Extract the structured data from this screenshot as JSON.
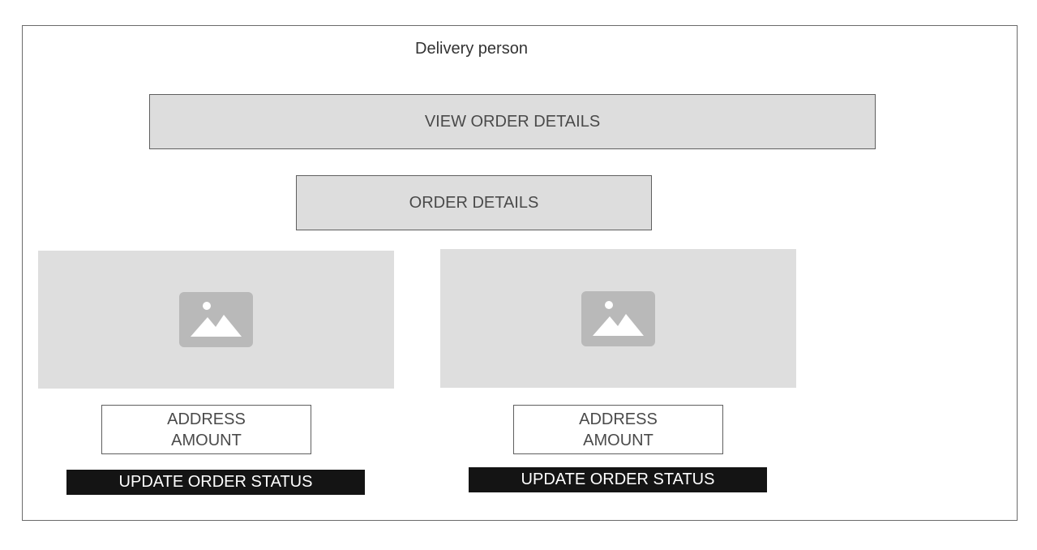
{
  "header": {
    "title": "Delivery person"
  },
  "actions": {
    "view_order_details": "VIEW ORDER DETAILS",
    "order_details": "ORDER DETAILS"
  },
  "orders": [
    {
      "image_icon": "image-placeholder-icon",
      "address": "ADDRESS",
      "amount": "AMOUNT",
      "update_label": "UPDATE ORDER STATUS"
    },
    {
      "image_icon": "image-placeholder-icon",
      "address": "ADDRESS",
      "amount": "AMOUNT",
      "update_label": "UPDATE ORDER STATUS"
    }
  ],
  "colors": {
    "button_gray": "#dddddd",
    "button_dark": "#141414",
    "placeholder": "#dedede",
    "placeholder_icon": "#b9b9b9"
  }
}
